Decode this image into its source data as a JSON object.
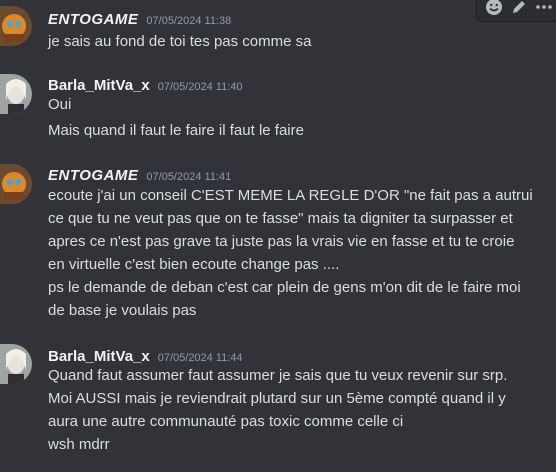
{
  "messages": [
    {
      "author": "ENTOGAME",
      "timestamp": "07/05/2024 11:38",
      "lines": [
        "je sais au fond de toi tes pas comme sa"
      ]
    },
    {
      "author": "Barla_MitVa_x",
      "timestamp": "07/05/2024 11:40",
      "lines": [
        "Oui",
        "Mais quand il faut le faire il faut le faire"
      ]
    },
    {
      "author": "ENTOGAME",
      "timestamp": "07/05/2024 11:41",
      "lines": [
        "ecoute j'ai un conseil C'EST MEME LA REGLE D'OR \"ne fait pas a autrui",
        "ce que tu ne veut pas que on te fasse\" mais ta digniter ta surpasser et",
        "apres ce n'est pas grave ta juste pas la vrais vie en fasse et tu te croie",
        "en virtuelle c'est bien ecoute change pas ....",
        "ps le demande de deban c'est car plein de gens m'on dit de le faire moi",
        "de base je voulais pas"
      ]
    },
    {
      "author": "Barla_MitVa_x",
      "timestamp": "07/05/2024 11:44",
      "lines": [
        "Quand faut assumer faut assumer je sais que tu veux revenir sur srp.",
        "Moi AUSSI mais je reviendrait plutard sur un 5ème compté  quand il y",
        "aura une autre communauté pas toxic comme celle ci",
        "wsh mdrr"
      ]
    }
  ],
  "toolbar": {
    "icons": [
      "emoji-icon",
      "pencil-icon",
      "more-icon"
    ]
  },
  "colors": {
    "background": "#313338",
    "text": "#dbdee1",
    "timestamp": "#949ba4",
    "username": "#f2f3f5"
  }
}
